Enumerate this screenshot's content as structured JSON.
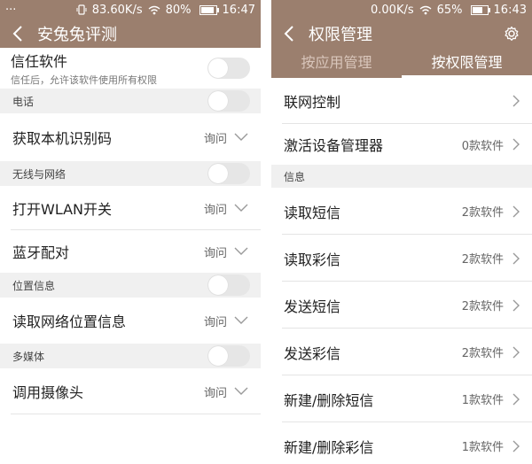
{
  "left": {
    "status": {
      "dots": "···",
      "speed": "83.60K/s",
      "battery": "80%",
      "time": "16:47",
      "battery_level": 0.8
    },
    "title": "安兔兔评测",
    "trust": {
      "label": "信任软件",
      "desc": "信任后，允许该软件使用所有权限"
    },
    "sections": [
      {
        "title": "电话",
        "items": [
          {
            "label": "获取本机识别码",
            "value": "询问"
          }
        ]
      },
      {
        "title": "无线与网络",
        "items": [
          {
            "label": "打开WLAN开关",
            "value": "询问"
          },
          {
            "label": "蓝牙配对",
            "value": "询问"
          }
        ]
      },
      {
        "title": "位置信息",
        "items": [
          {
            "label": "读取网络位置信息",
            "value": "询问"
          }
        ]
      },
      {
        "title": "多媒体",
        "items": [
          {
            "label": "调用摄像头",
            "value": "询问"
          }
        ]
      }
    ]
  },
  "right": {
    "status": {
      "speed": "0.00K/s",
      "battery": "65%",
      "time": "16:43",
      "battery_level": 0.65
    },
    "title": "权限管理",
    "tabs": [
      "按应用管理",
      "按权限管理"
    ],
    "active_tab": 1,
    "top_items": [
      {
        "label": "联网控制",
        "value": ""
      },
      {
        "label": "激活设备管理器",
        "value": "0款软件"
      }
    ],
    "section_title": "信息",
    "items": [
      {
        "label": "读取短信",
        "value": "2款软件"
      },
      {
        "label": "读取彩信",
        "value": "2款软件"
      },
      {
        "label": "发送短信",
        "value": "2款软件"
      },
      {
        "label": "发送彩信",
        "value": "2款软件"
      },
      {
        "label": "新建/删除短信",
        "value": "1款软件"
      },
      {
        "label": "新建/删除彩信",
        "value": "1款软件"
      }
    ]
  },
  "colors": {
    "header": "#9b7f6e",
    "section_bg": "#f0f0f0",
    "toggle_off": "#e6e6e6"
  },
  "icons": [
    "back-arrow",
    "gear",
    "chevron-down",
    "chevron-right",
    "wifi",
    "battery",
    "vibrate"
  ]
}
